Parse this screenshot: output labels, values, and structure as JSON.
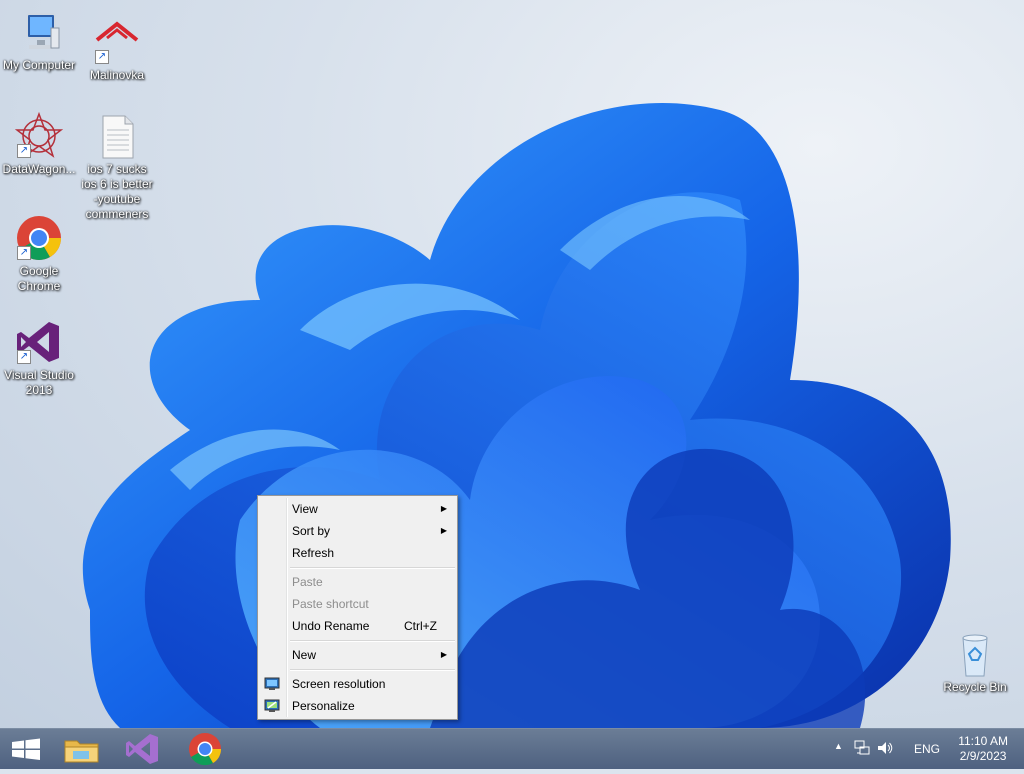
{
  "desktop_icons": {
    "my_computer": "My Computer",
    "malinovka": "Malinovka",
    "datawagon": "DataWagon...",
    "text_file": "ios 7 sucks ios 6 is better -youtube commeners",
    "chrome": "Google Chrome",
    "visual_studio": "Visual Studio 2013",
    "recycle_bin": "Recycle Bin"
  },
  "context_menu": {
    "view": "View",
    "sort_by": "Sort by",
    "refresh": "Refresh",
    "paste": "Paste",
    "paste_shortcut": "Paste shortcut",
    "undo_rename": "Undo Rename",
    "undo_shortcut": "Ctrl+Z",
    "new": "New",
    "screen_resolution": "Screen resolution",
    "personalize": "Personalize"
  },
  "taskbar": {
    "language": "ENG",
    "time": "11:10 AM",
    "date": "2/9/2023"
  }
}
